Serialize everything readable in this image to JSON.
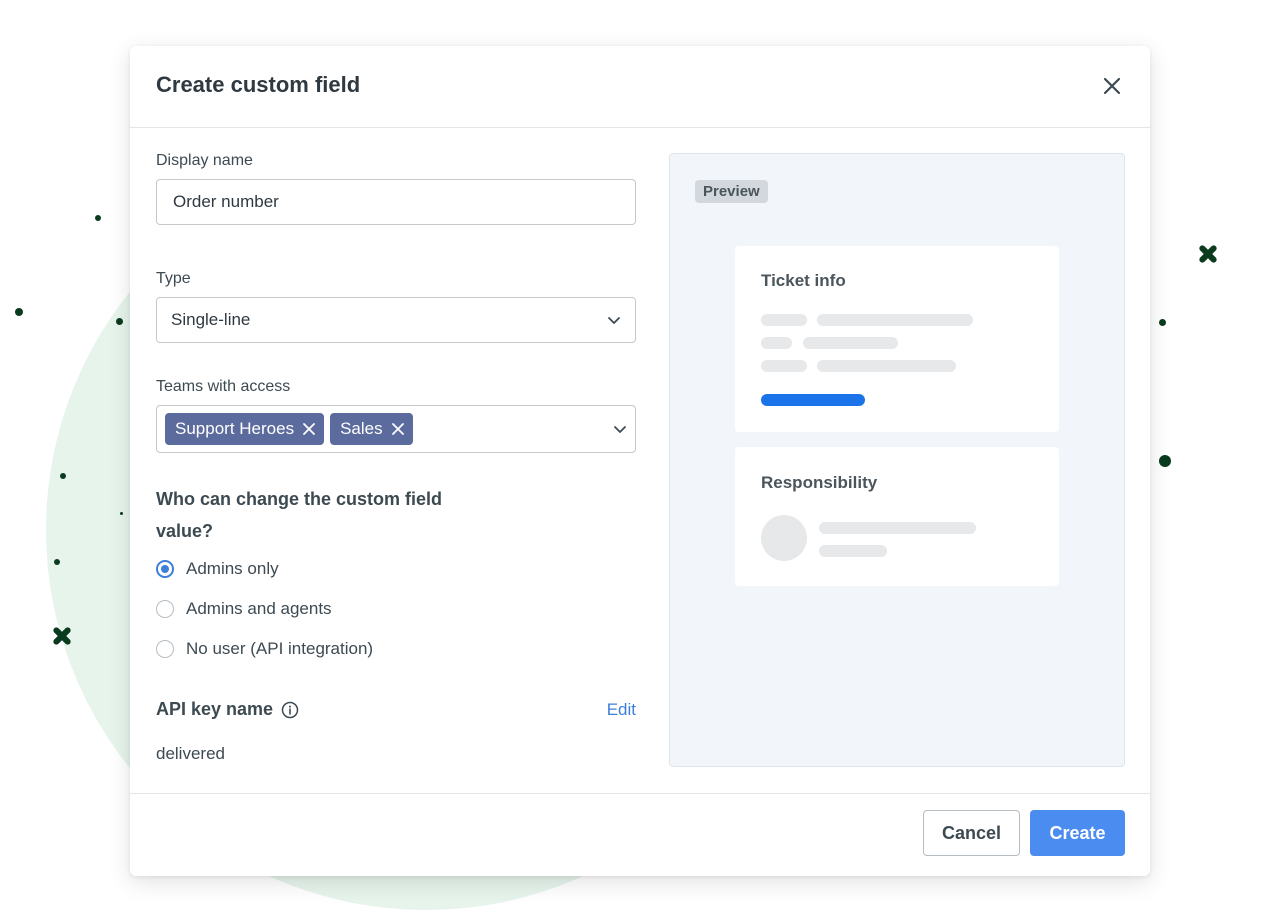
{
  "modal": {
    "title": "Create custom field",
    "display_name": {
      "label": "Display name",
      "value": "Order number"
    },
    "type": {
      "label": "Type",
      "selected": "Single-line"
    },
    "teams": {
      "label": "Teams with access",
      "tags": [
        "Support Heroes",
        "Sales"
      ]
    },
    "permissions": {
      "title": "Who can change the custom field value?",
      "options": [
        {
          "label": "Admins only",
          "checked": true
        },
        {
          "label": "Admins and agents",
          "checked": false
        },
        {
          "label": "No user (API integration)",
          "checked": false
        }
      ]
    },
    "api_key": {
      "title": "API key name",
      "edit_label": "Edit",
      "value": "delivered"
    },
    "preview": {
      "badge": "Preview",
      "ticket_card_title": "Ticket info",
      "responsibility_card_title": "Responsibility"
    },
    "footer": {
      "cancel_label": "Cancel",
      "create_label": "Create"
    }
  },
  "colors": {
    "accent": "#4b8cf0",
    "tag": "#5c6b9d",
    "link": "#3d7fd9",
    "preview_bg": "#f2f6fa",
    "decoration": "#0b3b1f",
    "background_circle": "#e6f4ec"
  },
  "icons": [
    "close-icon",
    "chevron-down-icon",
    "tag-remove-icon",
    "info-icon"
  ]
}
